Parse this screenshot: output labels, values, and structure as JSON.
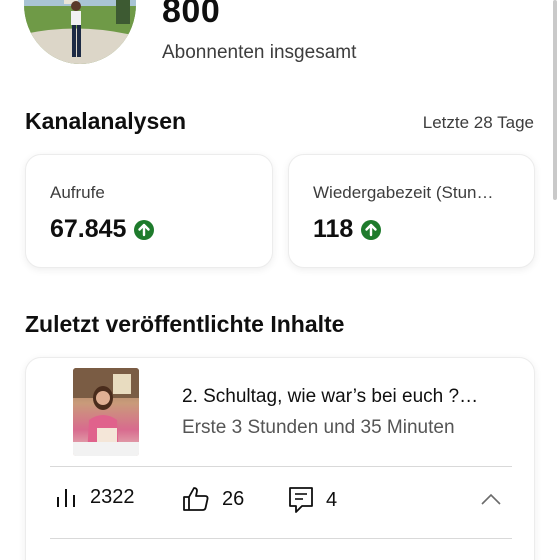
{
  "header": {
    "subscriber_count": "800",
    "subscriber_label": "Abonnenten insgesamt"
  },
  "analytics": {
    "title": "Kanalanalysen",
    "range": "Letzte 28 Tage",
    "metrics": [
      {
        "label": "Aufrufe",
        "value": "67.845",
        "trend_icon": "arrow-up-circle-icon"
      },
      {
        "label": "Wiedergabezeit (Stun…",
        "value": "118",
        "trend_icon": "arrow-up-circle-icon"
      }
    ],
    "trend_color": "#1e7b2c"
  },
  "recent": {
    "title": "Zuletzt veröffentlichte Inhalte",
    "video": {
      "title": "2. Schultag, wie war’s bei euch ?…",
      "subtitle": "Erste 3 Stunden und 35 Minuten",
      "views": "2322",
      "likes": "26",
      "comments": "4"
    }
  }
}
